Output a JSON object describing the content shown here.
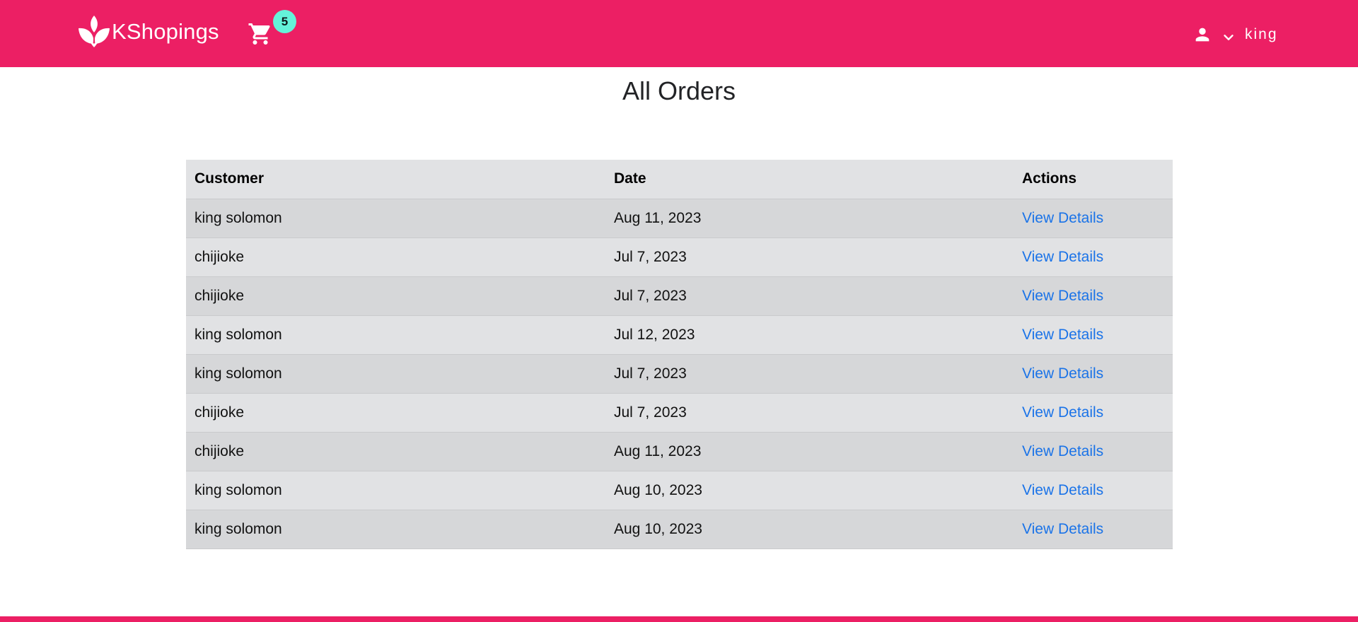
{
  "colors": {
    "brand": "#EC1F64",
    "badge": "#64F3D9",
    "link": "#1a73e8",
    "row_odd": "#d6d7d9",
    "row_even": "#e1e2e4"
  },
  "header": {
    "brand_name": "KShopings",
    "logo_icon": "lotus-icon",
    "cart_icon": "shopping-cart-icon",
    "cart_count": "5",
    "user_icon": "person-icon",
    "chevron_icon": "chevron-down-icon",
    "user_name": "king"
  },
  "main": {
    "title": "All Orders",
    "table": {
      "headers": {
        "customer": "Customer",
        "date": "Date",
        "actions": "Actions"
      },
      "rows": [
        {
          "customer": "king solomon",
          "date": "Aug 11, 2023",
          "action": "View Details"
        },
        {
          "customer": "chijioke",
          "date": "Jul 7, 2023",
          "action": "View Details"
        },
        {
          "customer": "chijioke",
          "date": "Jul 7, 2023",
          "action": "View Details"
        },
        {
          "customer": "king solomon",
          "date": "Jul 12, 2023",
          "action": "View Details"
        },
        {
          "customer": "king solomon",
          "date": "Jul 7, 2023",
          "action": "View Details"
        },
        {
          "customer": "chijioke",
          "date": "Jul 7, 2023",
          "action": "View Details"
        },
        {
          "customer": "chijioke",
          "date": "Aug 11, 2023",
          "action": "View Details"
        },
        {
          "customer": "king solomon",
          "date": "Aug 10, 2023",
          "action": "View Details"
        },
        {
          "customer": "king solomon",
          "date": "Aug 10, 2023",
          "action": "View Details"
        }
      ]
    }
  }
}
